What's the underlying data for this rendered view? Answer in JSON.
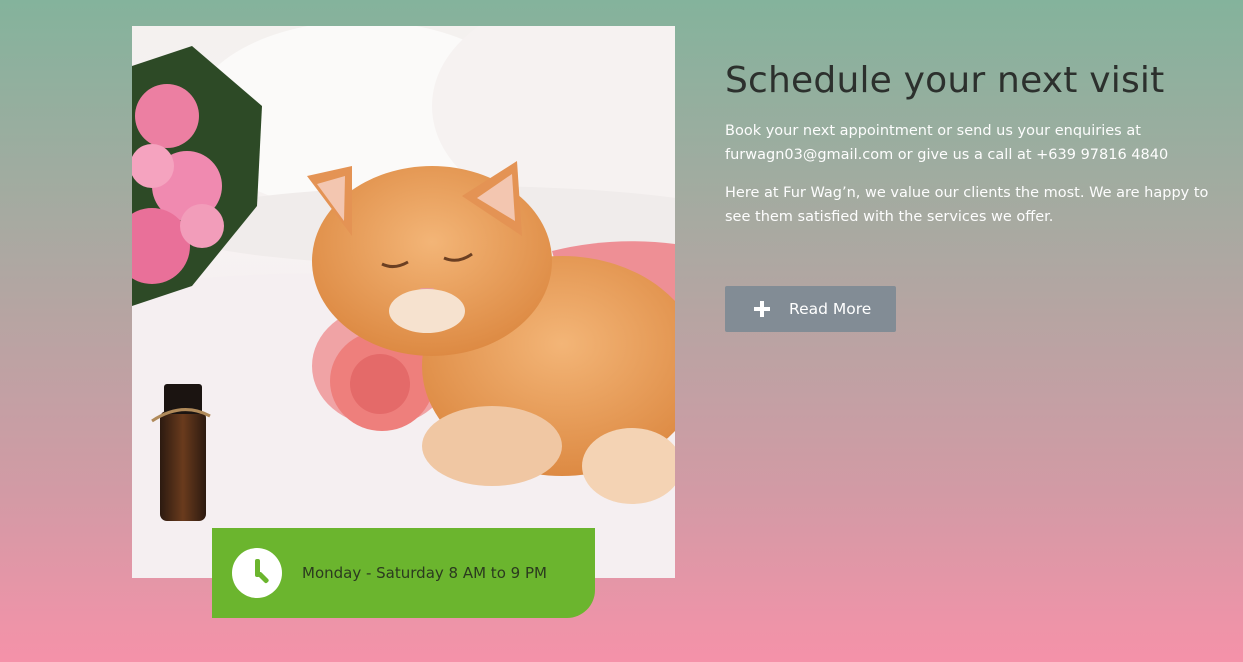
{
  "image": {
    "alt": "Orange cat sleeping on a rolled pink towel next to pink roses and an essential oil bottle",
    "icon": "cat-spa-photo"
  },
  "hours": {
    "icon": "clock-icon",
    "text": "Monday - Saturday 8 AM to 9 PM",
    "color": "#6bb52e"
  },
  "main": {
    "title": "Schedule your next visit",
    "paragraph1": "Book your next appointment or send us your enquiries at furwagn03@gmail.com or give us a call at +639 97816 4840",
    "paragraph2": "Here at Fur Wag’n, we value our clients the most. We are happy to see them satisfied with the services we offer."
  },
  "button": {
    "icon": "plus-icon",
    "label": "Read More",
    "color": "#828c95"
  }
}
